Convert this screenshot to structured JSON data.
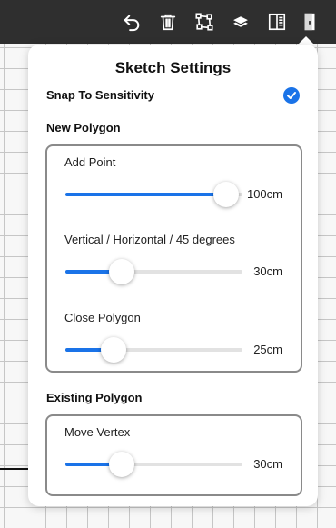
{
  "toolbar": {
    "icons": [
      "undo-icon",
      "trash-icon",
      "polygon-nodes-icon",
      "layers-icon",
      "panel-icon",
      "door-icon"
    ]
  },
  "panel": {
    "title": "Sketch Settings",
    "snap_label": "Snap To Sensitivity",
    "snap_enabled": true,
    "new_polygon": {
      "title": "New Polygon",
      "sliders": [
        {
          "label": "Add Point",
          "value_text": "100cm",
          "fraction": 0.91
        },
        {
          "label": "Vertical / Horizontal / 45 degrees",
          "value_text": "30cm",
          "fraction": 0.32
        },
        {
          "label": "Close Polygon",
          "value_text": "25cm",
          "fraction": 0.27
        }
      ]
    },
    "existing_polygon": {
      "title": "Existing Polygon",
      "sliders": [
        {
          "label": "Move Vertex",
          "value_text": "30cm",
          "fraction": 0.32
        }
      ]
    }
  },
  "colors": {
    "toolbar_bg": "#2f2f2f",
    "accent": "#1a73e8",
    "grid_line": "#c6c6c6",
    "group_border": "#8a8a8a"
  }
}
